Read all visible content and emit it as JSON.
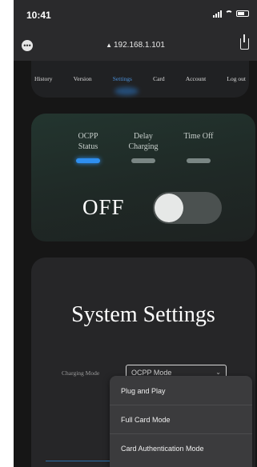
{
  "status_bar": {
    "time": "10:41"
  },
  "browser": {
    "url": "192.168.1.101"
  },
  "nav": {
    "items": [
      "History",
      "Version",
      "Settings",
      "Card",
      "Account",
      "Log out"
    ],
    "active": "Settings"
  },
  "controls": {
    "tabs": [
      {
        "line1": "OCPP",
        "line2": "Status"
      },
      {
        "line1": "Delay",
        "line2": "Charging"
      },
      {
        "line1": "Time Off",
        "line2": ""
      }
    ],
    "active_tab": 0,
    "toggle_label": "OFF"
  },
  "settings": {
    "title": "System Settings",
    "charging_mode_label": "Charging Mode",
    "charging_mode_value": "OCPP Mode",
    "options": [
      "Plug and Play",
      "Full Card Mode",
      "Card Authentication Mode"
    ]
  },
  "colors": {
    "accent": "#2f8ff0",
    "toggle_off": "#4b5150"
  }
}
